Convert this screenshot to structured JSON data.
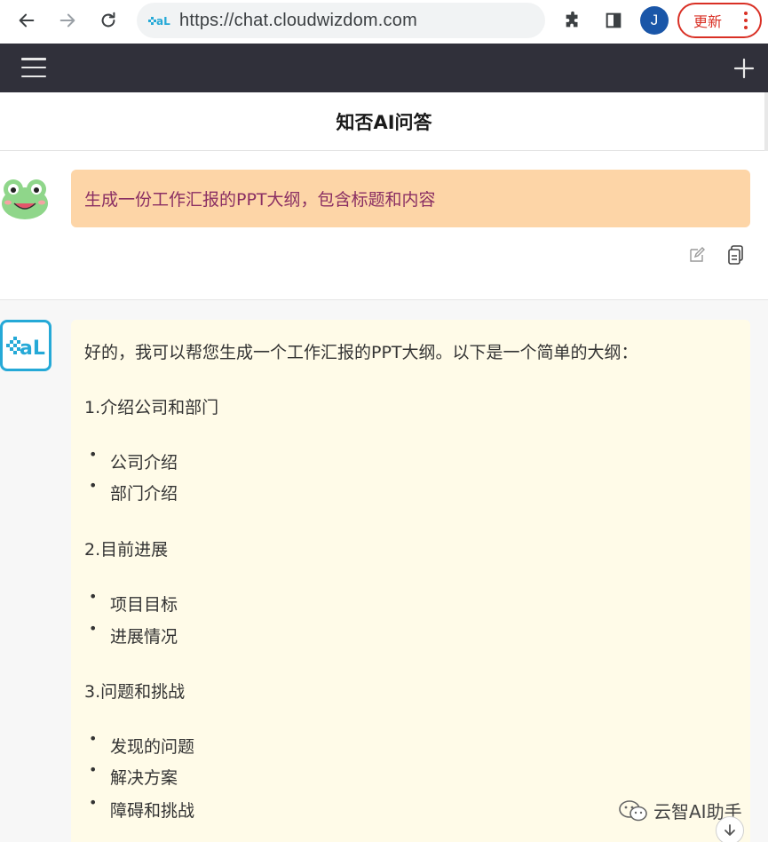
{
  "browser": {
    "url": "https://chat.cloudwizdom.com",
    "avatar_letter": "J",
    "update_label": "更新"
  },
  "header": {
    "title": "知否AI问答"
  },
  "user_message": {
    "text": "生成一份工作汇报的PPT大纲，包含标题和内容"
  },
  "ai_message": {
    "intro": "好的，我可以帮您生成一个工作汇报的PPT大纲。以下是一个简单的大纲：",
    "sections": [
      {
        "heading": "1.介绍公司和部门",
        "items": [
          "公司介绍",
          "部门介绍"
        ]
      },
      {
        "heading": "2.目前进展",
        "items": [
          "项目目标",
          "进展情况"
        ]
      },
      {
        "heading": "3.问题和挑战",
        "items": [
          "发现的问题",
          "解决方案",
          "障碍和挑战"
        ]
      }
    ]
  },
  "watermark": {
    "text": "云智AI助手"
  },
  "colors": {
    "header_bg": "#30303a",
    "user_bubble": "#fdd5a7",
    "user_text": "#8a2f63",
    "ai_bubble": "#fffbe8",
    "update_red": "#d93025",
    "ai_logo_blue": "#25a9d7"
  }
}
